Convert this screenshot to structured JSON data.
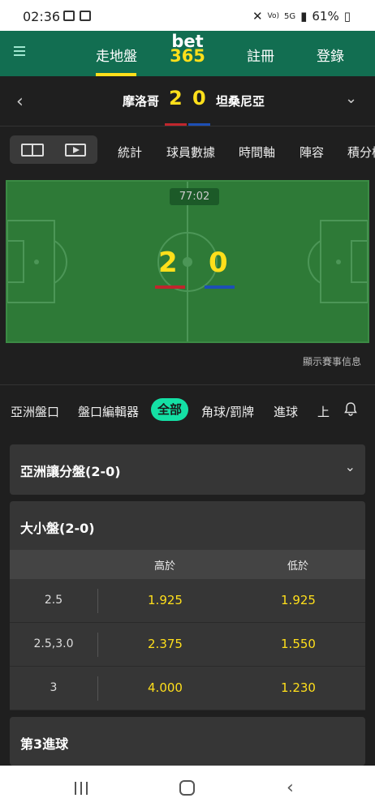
{
  "status": {
    "time": "02:36",
    "battery": "61%",
    "network": "5G"
  },
  "header": {
    "nav_live": "走地盤",
    "logo_top": "bet",
    "logo_bottom": "365",
    "nav_register": "註冊",
    "nav_login": "登錄"
  },
  "match": {
    "home": "摩洛哥",
    "away": "坦桑尼亞",
    "home_score": "2",
    "away_score": "0",
    "clock": "77:02",
    "home_color": "#c0262d",
    "away_color": "#1d4fb5"
  },
  "sub_tabs": [
    "統計",
    "球員數據",
    "時間軸",
    "陣容",
    "積分榜"
  ],
  "show_info": "顯示賽事信息",
  "filters": {
    "items": [
      "亞洲盤口",
      "盤口編輯器",
      "全部",
      "角球/罰牌",
      "進球",
      "上"
    ],
    "active": "全部"
  },
  "markets": {
    "asian_handicap": {
      "title": "亞洲讓分盤(2-0)"
    },
    "over_under": {
      "title": "大小盤(2-0)",
      "col_over": "高於",
      "col_under": "低於",
      "rows": [
        {
          "line": "2.5",
          "over": "1.925",
          "under": "1.925"
        },
        {
          "line": "2.5,3.0",
          "over": "2.375",
          "under": "1.550"
        },
        {
          "line": "3",
          "over": "4.000",
          "under": "1.230"
        }
      ]
    },
    "third_goal": {
      "title": "第3進球"
    }
  },
  "icons": {
    "menu": "hamburger-icon",
    "back": "chevron-left-icon",
    "expand": "chevron-down-icon",
    "bell": "bell-icon"
  },
  "colors": {
    "brand_green": "#126e51",
    "accent_yellow": "#ffdf1b",
    "active_pill": "#14e0a5"
  }
}
